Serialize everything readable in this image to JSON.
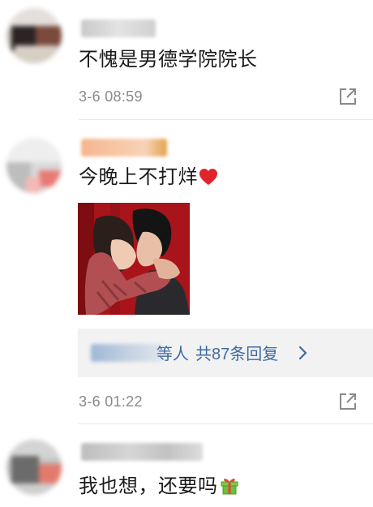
{
  "comments": [
    {
      "text": "不愧是男德学院院长",
      "timestamp": "3-6 08:59",
      "share_icon": "share-icon"
    },
    {
      "text": "今晚上不打烊",
      "emoji": "heart-icon",
      "timestamp": "3-6 01:22",
      "share_icon": "share-icon",
      "replies": {
        "name_suffix": "等人",
        "count_label": "共87条回复",
        "chevron": "chevron-right-icon"
      }
    },
    {
      "text": "我也想，还要吗",
      "emoji": "gift-icon"
    }
  ],
  "colors": {
    "link": "#3d6aa3",
    "timestamp": "#8a8a8a",
    "reply_bg": "#f2f2f2",
    "heart": "#e0242b",
    "gift": "#6fbf3a"
  }
}
